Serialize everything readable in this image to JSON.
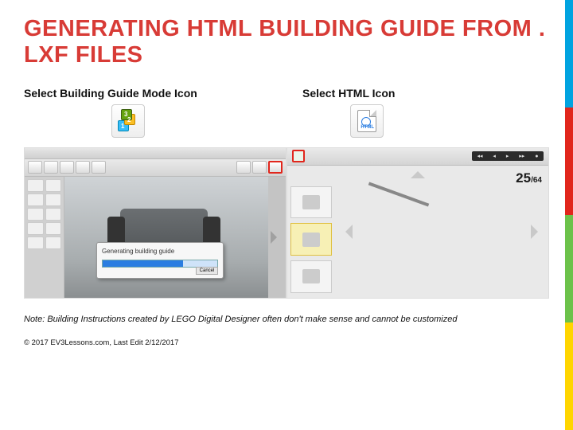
{
  "title": "GENERATING HTML BUILDING GUIDE FROM . LXF FILES",
  "col_left_heading": "Select Building Guide Mode Icon",
  "col_right_heading": "Select HTML Icon",
  "dialog_text": "Generating building guide",
  "dialog_button": "Cancel",
  "step_current": "25",
  "step_sep_total": "/64",
  "play_symbols": [
    "◂◂",
    "◂",
    "▸",
    "▸▸",
    "●"
  ],
  "note": "Note: Building Instructions created by LEGO Digital Designer often don't make sense and cannot be customized",
  "copyright": "© 2017 EV3Lessons.com, Last Edit 2/12/2017"
}
